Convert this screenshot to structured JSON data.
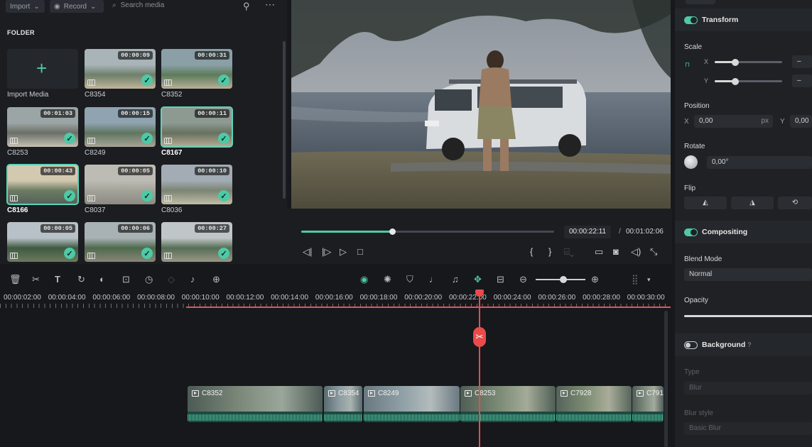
{
  "media": {
    "import_label": "Import",
    "record_label": "Record",
    "search_placeholder": "Search media",
    "folder_label": "FOLDER",
    "import_media_label": "Import Media",
    "thumbs": [
      {
        "name": "C8354",
        "duration": "00:00:09",
        "selected": false
      },
      {
        "name": "C8352",
        "duration": "00:00:31",
        "selected": false
      },
      {
        "name": "C8253",
        "duration": "00:01:03",
        "selected": false
      },
      {
        "name": "C8249",
        "duration": "00:00:15",
        "selected": false
      },
      {
        "name": "C8167",
        "duration": "00:00:11",
        "selected": true
      },
      {
        "name": "C8166",
        "duration": "00:00:43",
        "selected": true
      },
      {
        "name": "C8037",
        "duration": "00:00:05",
        "selected": false
      },
      {
        "name": "C8036",
        "duration": "00:00:10",
        "selected": false
      },
      {
        "name": "",
        "duration": "00:00:05",
        "selected": false
      },
      {
        "name": "",
        "duration": "00:00:06",
        "selected": false
      },
      {
        "name": "",
        "duration": "00:00:27",
        "selected": false
      }
    ]
  },
  "player": {
    "current_time": "00:00:22:11",
    "separator": "/",
    "total_time": "00:01:02:06",
    "progress": 0.36
  },
  "properties": {
    "transform_label": "Transform",
    "scale_label": "Scale",
    "scale_x_label": "X",
    "scale_y_label": "Y",
    "scale_x_value": "–",
    "scale_y_value": "–",
    "position_label": "Position",
    "pos_x_label": "X",
    "pos_x_value": "0,00",
    "pos_x_unit": "px",
    "pos_y_label": "Y",
    "pos_y_value": "0,00",
    "rotate_label": "Rotate",
    "rotate_value": "0,00°",
    "flip_label": "Flip",
    "compositing_label": "Compositing",
    "blend_mode_label": "Blend Mode",
    "blend_mode_value": "Normal",
    "opacity_label": "Opacity",
    "background_label": "Background",
    "type_label": "Type",
    "type_value": "Blur",
    "blur_style_label": "Blur style",
    "blur_style_value": "Basic Blur"
  },
  "timeline": {
    "ruler": [
      "00:00:02:00",
      "00:00:04:00",
      "00:00:06:00",
      "00:00:08:00",
      "00:00:10:00",
      "00:00:12:00",
      "00:00:14:00",
      "00:00:16:00",
      "00:00:18:00",
      "00:00:20:00",
      "00:00:22:00",
      "00:00:24:00",
      "00:00:26:00",
      "00:00:28:00",
      "00:00:30:00"
    ],
    "clips": [
      {
        "name": "C8352",
        "selected": true
      },
      {
        "name": "C8354",
        "selected": true
      },
      {
        "name": "C8249",
        "selected": false
      },
      {
        "name": "C8253",
        "selected": false
      },
      {
        "name": "C7928",
        "selected": false
      },
      {
        "name": "C791",
        "selected": false
      }
    ]
  },
  "colors": {
    "accent": "#4ec9a6",
    "playhead": "#e94b4b",
    "panel": "#1b1d21"
  }
}
